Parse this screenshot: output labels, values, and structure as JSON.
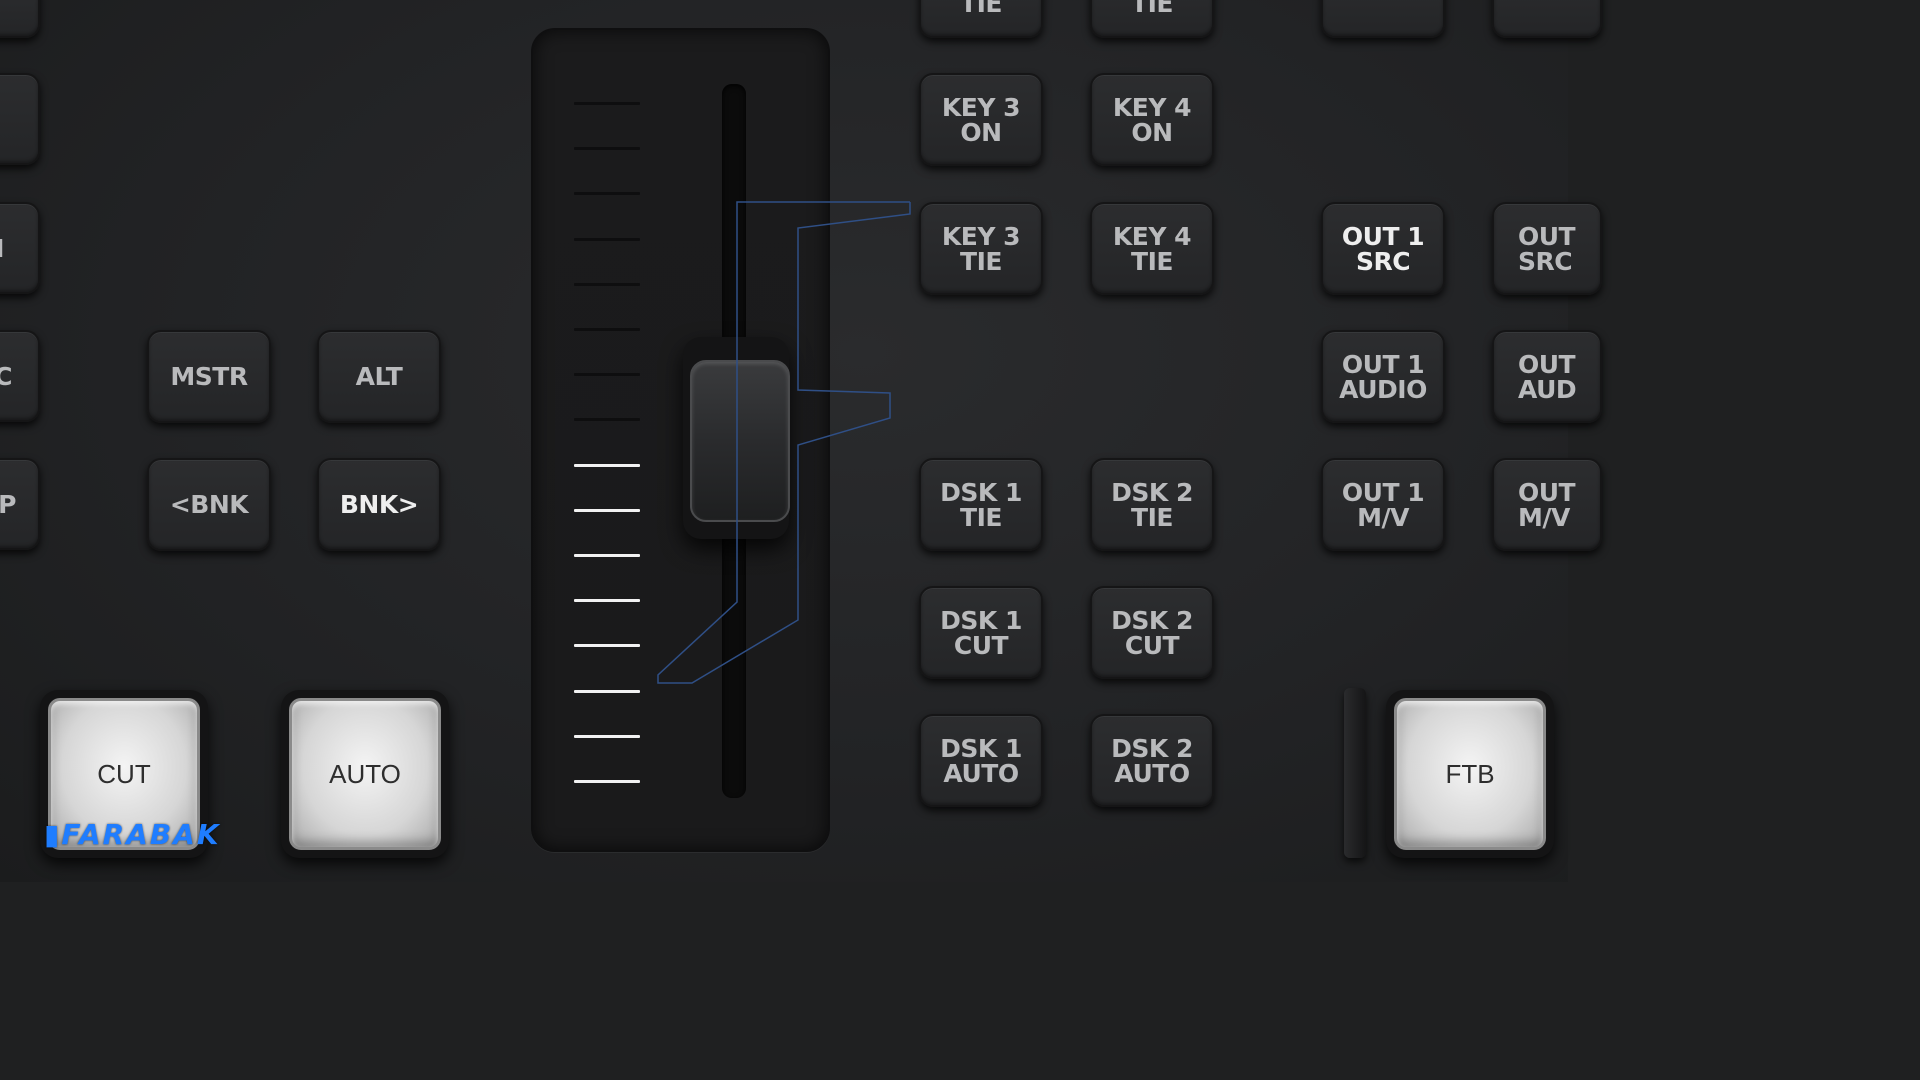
{
  "left_column": {
    "edge_buttons": [
      "",
      "",
      "M",
      "C",
      "P"
    ]
  },
  "bank": {
    "mstr_label": "MSTR",
    "alt_label": "ALT",
    "prev_bank_label": "<BNK",
    "next_bank_label": "BNK>"
  },
  "transition": {
    "cut_label": "CUT",
    "auto_label": "AUTO",
    "ftb_label": "FTB",
    "fader_position": 0.42
  },
  "keyers": {
    "key3_tie_top": "TIE",
    "key4_tie_top": "TIE",
    "key3_on": "KEY 3\nON",
    "key4_on": "KEY 4\nON",
    "key3_tie": "KEY 3\nTIE",
    "key4_tie": "KEY 4\nTIE",
    "dsk1_tie": "DSK 1\nTIE",
    "dsk2_tie": "DSK 2\nTIE",
    "dsk1_cut": "DSK 1\nCUT",
    "dsk2_cut": "DSK 2\nCUT",
    "dsk1_auto": "DSK 1\nAUTO",
    "dsk2_auto": "DSK 2\nAUTO"
  },
  "outputs": {
    "out1_src": "OUT 1\nSRC",
    "out2_src": "OUT\nSRC",
    "out1_audio": "OUT 1\nAUDIO",
    "out2_audio": "OUT\nAUD",
    "out1_mv": "OUT 1\nM/V",
    "out2_mv": "OUT\nM/V"
  },
  "watermark": {
    "text": "FARABAK",
    "color": "#1f7dff"
  },
  "colors": {
    "panel": "#222325",
    "tick_lit": "#f2f2f2",
    "tick_dim": "#0e0e0f",
    "guide_line": "#2f4f86"
  }
}
